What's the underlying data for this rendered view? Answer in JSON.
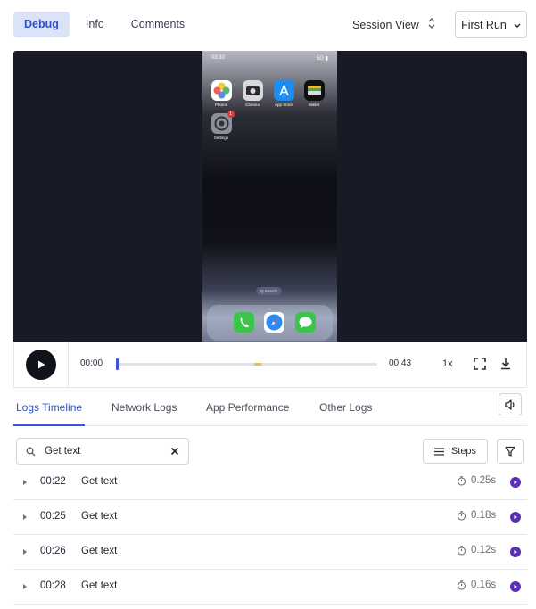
{
  "top_tabs": [
    {
      "label": "Debug",
      "active": true
    },
    {
      "label": "Info",
      "active": false
    },
    {
      "label": "Comments",
      "active": false
    }
  ],
  "view_select": {
    "value": "Session View",
    "icon": "chevron-updown-icon"
  },
  "run_select": {
    "value": "First Run",
    "icon": "chevron-down-icon"
  },
  "phone": {
    "status_time": "08:33",
    "status_right": "5G ▮",
    "apps": [
      {
        "label": "Photos",
        "icon": "photos-icon"
      },
      {
        "label": "Camera",
        "icon": "camera-icon"
      },
      {
        "label": "App Store",
        "icon": "app-store-icon"
      },
      {
        "label": "Wallet",
        "icon": "wallet-icon"
      },
      {
        "label": "Settings",
        "icon": "settings-icon",
        "badge": "1"
      }
    ],
    "search_pill": "Q Search",
    "dock": [
      {
        "icon": "phone-icon"
      },
      {
        "icon": "safari-icon"
      },
      {
        "icon": "messages-icon"
      }
    ]
  },
  "player_controls": {
    "current_time": "00:00",
    "total_time": "00:43",
    "speed": "1x",
    "progress": 0.0,
    "marker_position": 0.53
  },
  "log_tabs": [
    {
      "label": "Logs Timeline",
      "active": true
    },
    {
      "label": "Network Logs",
      "active": false
    },
    {
      "label": "App Performance",
      "active": false
    },
    {
      "label": "Other Logs",
      "active": false
    }
  ],
  "search": {
    "value": "Get text",
    "icon": "search-icon",
    "clear_icon": "close-icon"
  },
  "steps_button": {
    "label": "Steps",
    "icon": "list-icon"
  },
  "filter_button": {
    "icon": "filter-icon"
  },
  "logs": [
    {
      "time": "00:22",
      "name": "Get text",
      "duration": "0.25s"
    },
    {
      "time": "00:25",
      "name": "Get text",
      "duration": "0.18s"
    },
    {
      "time": "00:26",
      "name": "Get text",
      "duration": "0.12s"
    },
    {
      "time": "00:28",
      "name": "Get text",
      "duration": "0.16s"
    }
  ],
  "colors": {
    "accent": "#3a55d6",
    "status": "#5a2fb4",
    "marker": "#f2c230"
  }
}
